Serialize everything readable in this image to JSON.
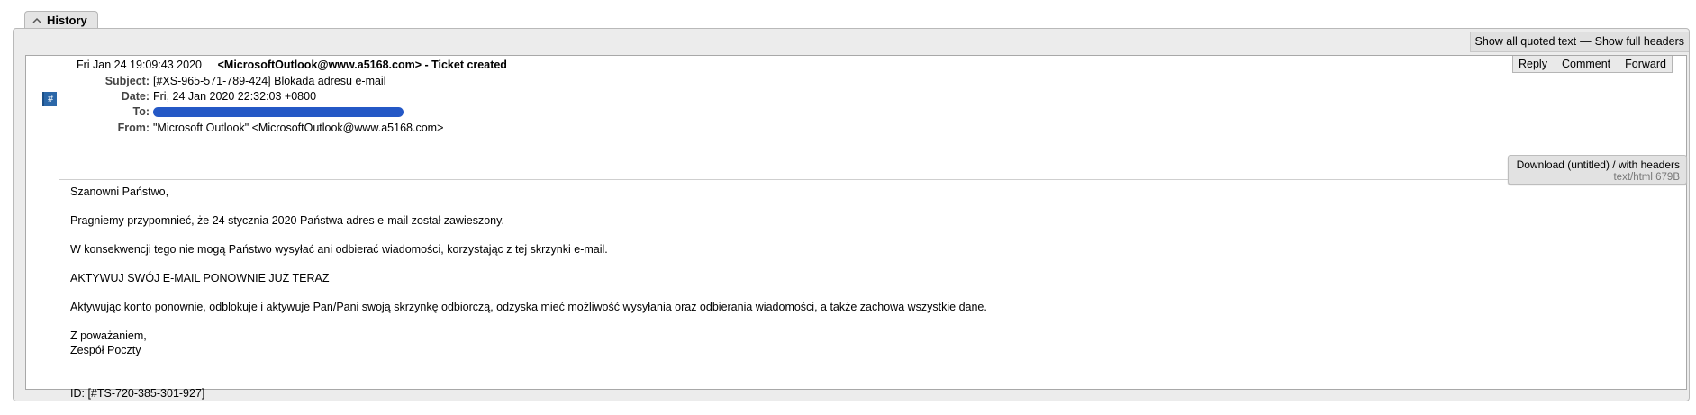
{
  "history": {
    "tab_label": "History"
  },
  "top_actions": {
    "show_quoted": "Show all quoted text",
    "separator": "—",
    "show_headers": "Show full headers"
  },
  "transaction": {
    "marker": "#",
    "date": "Fri Jan 24 19:09:43 2020",
    "description": "<MicrosoftOutlook@www.a5168.com> - Ticket created",
    "actions": {
      "reply": "Reply",
      "comment": "Comment",
      "forward": "Forward"
    },
    "headers": [
      {
        "label": "Subject:",
        "value": "[#XS-965-571-789-424] Blokada adresu e-mail"
      },
      {
        "label": "Date:",
        "value": "Fri, 24 Jan 2020 22:32:03 +0800"
      },
      {
        "label": "To:",
        "value": ""
      },
      {
        "label": "From:",
        "value": "\"Microsoft Outlook\" <MicrosoftOutlook@www.a5168.com>"
      }
    ],
    "download": {
      "link": "Download (untitled) / with headers",
      "info": "text/html 679B"
    },
    "body": [
      "Szanowni Państwo,",
      "Pragniemy przypomnieć, że 24 stycznia 2020 Państwa adres e-mail został zawieszony.",
      "W konsekwencji tego nie mogą Państwo wysyłać ani odbierać wiadomości, korzystając z tej skrzynki e-mail.",
      "AKTYWUJ SWÓJ E-MAIL PONOWNIE JUŻ TERAZ",
      "Aktywując konto ponownie, odblokuje i aktywuje Pan/Pani swoją skrzynkę odbiorczą, odzyska mieć możliwość wysyłania oraz odbierania wiadomości, a także zachowa wszystkie dane.",
      "Z poważaniem,",
      "Zespół Poczty",
      "ID: [#TS-720-385-301-927]"
    ]
  },
  "colors": {
    "redaction": "#2458c6",
    "marker_bg": "#2b67a8"
  }
}
